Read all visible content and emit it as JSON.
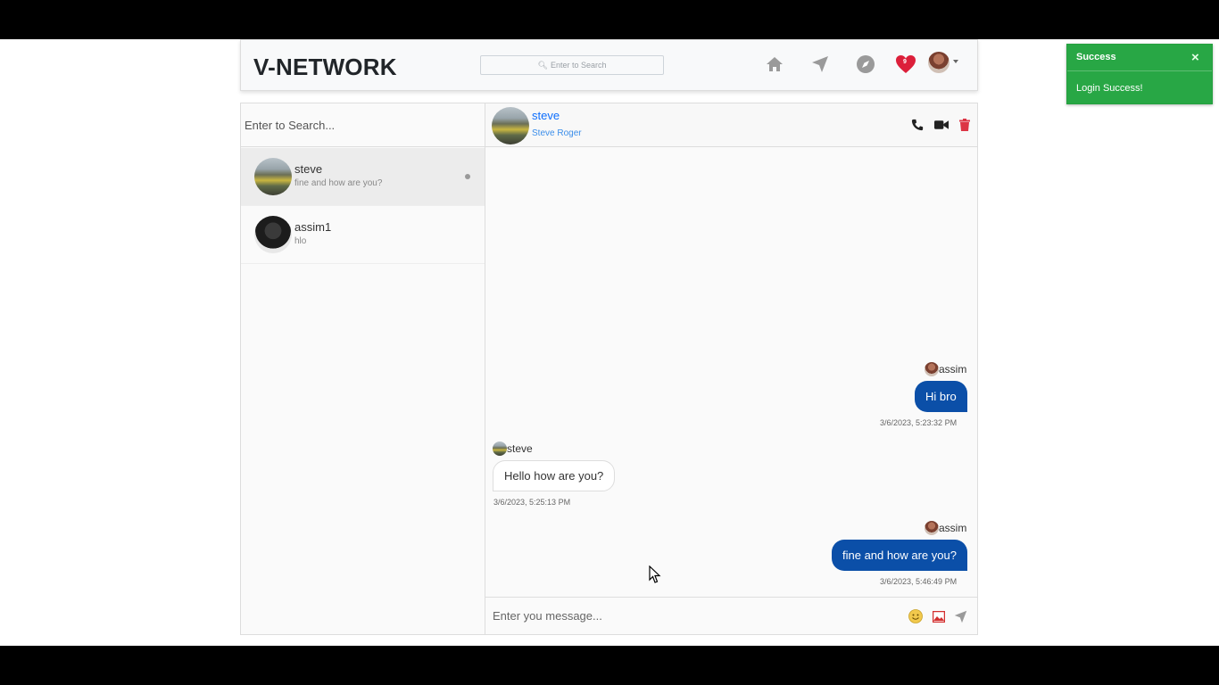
{
  "header": {
    "logo": "V-NETWORK",
    "search_placeholder": "Enter to Search",
    "nav_icons": [
      "home-icon",
      "send-icon",
      "compass-icon",
      "heart-icon"
    ],
    "notification_count": "9",
    "heart_color": "#dc3545"
  },
  "sidebar": {
    "search_placeholder": "Enter to Search...",
    "contacts": [
      {
        "name": "steve",
        "last_message": "fine and how are you?"
      },
      {
        "name": "assim1",
        "last_message": "hlo"
      }
    ]
  },
  "chat": {
    "header": {
      "name": "steve",
      "fullname": "Steve Roger"
    },
    "messages": [
      {
        "from": "assim",
        "text": "Hi bro",
        "time": "3/6/2023, 5:23:32 PM",
        "mine": true
      },
      {
        "from": "steve",
        "text": "Hello how are you?",
        "time": "3/6/2023, 5:25:13 PM",
        "mine": false
      },
      {
        "from": "assim",
        "text": "fine and how are you?",
        "time": "3/6/2023, 5:46:49 PM",
        "mine": true
      }
    ],
    "input_placeholder": "Enter you message..."
  },
  "toast": {
    "title": "Success",
    "message": "Login Success!",
    "close": "×",
    "color": "#28a745"
  },
  "colors": {
    "accent_blue": "#0d6efd",
    "bubble_blue": "#0b4fa8",
    "delete_red": "#dc3545"
  }
}
